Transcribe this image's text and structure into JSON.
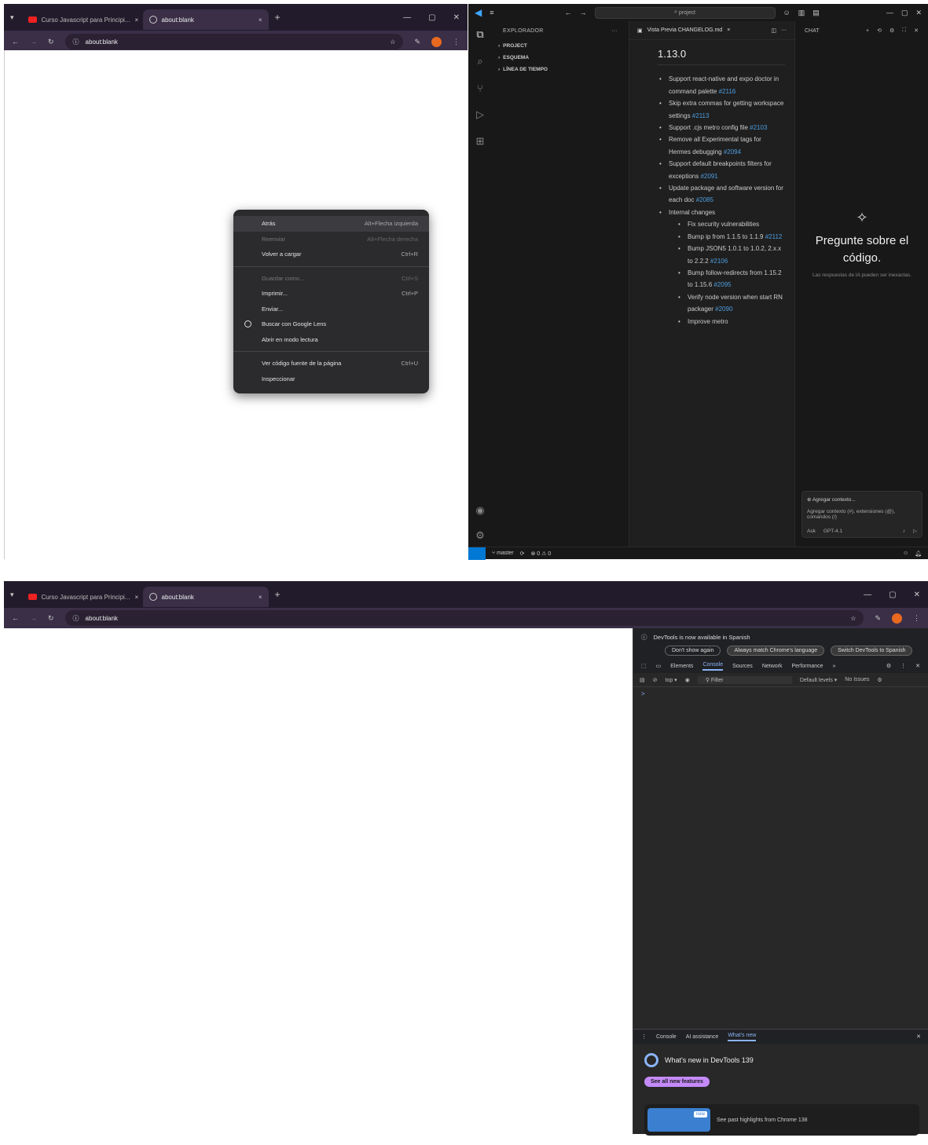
{
  "top_browser": {
    "tabs": [
      {
        "title": "Curso Javascript para Principi..."
      },
      {
        "title": "about:blank"
      }
    ],
    "new_tab": "+",
    "close": "×",
    "address": "about:blank",
    "controls": {
      "minimize": "—",
      "restore": "▢",
      "close": "✕"
    }
  },
  "context_menu": {
    "items": [
      {
        "label": "Atrás",
        "shortcut": "Alt+Flecha izquierda",
        "state": "highlight"
      },
      {
        "label": "Reenviar",
        "shortcut": "Alt+Flecha derecha",
        "state": "disabled"
      },
      {
        "label": "Volver a cargar",
        "shortcut": "Ctrl+R",
        "state": "normal"
      },
      {
        "sep": true
      },
      {
        "label": "Guardar como...",
        "shortcut": "Ctrl+S",
        "state": "disabled"
      },
      {
        "label": "Imprimir...",
        "shortcut": "Ctrl+P",
        "state": "normal"
      },
      {
        "label": "Enviar...",
        "shortcut": "",
        "state": "normal"
      },
      {
        "label": "Buscar con Google Lens",
        "shortcut": "",
        "state": "normal",
        "icon": "lens-icon"
      },
      {
        "label": "Abrir en modo lectura",
        "shortcut": "",
        "state": "normal"
      },
      {
        "sep": true
      },
      {
        "label": "Ver código fuente de la página",
        "shortcut": "Ctrl+U",
        "state": "normal"
      },
      {
        "label": "Inspeccionar",
        "shortcut": "",
        "state": "normal"
      }
    ]
  },
  "vscode": {
    "search": "project",
    "explorer_title": "EXPLORADOR",
    "explorer_items": [
      "PROJECT",
      "ESQUEMA",
      "LÍNEA DE TIEMPO"
    ],
    "editor_tab": "Vista Previa CHANGELOG.md",
    "changelog": {
      "version": "1.13.0",
      "items": [
        {
          "text": "Support react-native and expo doctor in command palette ",
          "link": "#2116"
        },
        {
          "text": "Skip extra commas for getting workspace settings ",
          "link": "#2113"
        },
        {
          "text": "Support .cjs metro config file ",
          "link": "#2103"
        },
        {
          "text": "Remove all Experimental tags for Hermes debugging ",
          "link": "#2094"
        },
        {
          "text": "Support default breakpoints filters for exceptions ",
          "link": "#2091"
        },
        {
          "text": "Update package and software version for each doc ",
          "link": "#2085"
        },
        {
          "text": "Internal changes",
          "link": "",
          "children": [
            {
              "text": "Fix security vulnerabilities",
              "link": ""
            },
            {
              "text": "Bump ip from 1.1.5 to 1.1.9 ",
              "link": "#2112"
            },
            {
              "text": "Bump JSON5 1.0.1 to 1.0.2, 2.x.x to 2.2.2 ",
              "link": "#2106"
            },
            {
              "text": "Bump follow-redirects from 1.15.2 to 1.15.6 ",
              "link": "#2095"
            },
            {
              "text": "Verify node version when start RN packager ",
              "link": "#2090"
            },
            {
              "text": "Improve metro",
              "link": ""
            }
          ]
        }
      ]
    },
    "chat": {
      "label": "CHAT",
      "title": "Pregunte sobre el código.",
      "subtitle": "Las respuestas de IA pueden ser inexactas.",
      "context_btn": "Agregar contexto...",
      "input_placeholder": "Agregar contexto (#), extensiones (@), comandos (/)",
      "mode": "Ask",
      "model": "GPT-4.1"
    },
    "status": {
      "branch": "master",
      "sync": "⟳",
      "problems": "⊗ 0 ⚠ 0"
    }
  },
  "bottom_browser": {
    "tabs": [
      {
        "title": "Curso Javascript para Principi..."
      },
      {
        "title": "about:blank"
      }
    ],
    "address": "about:blank"
  },
  "devtools": {
    "notice": "DevTools is now available in Spanish",
    "buttons": [
      "Don't show again",
      "Always match Chrome's language",
      "Switch DevTools to Spanish"
    ],
    "tabs": [
      "Elements",
      "Console",
      "Sources",
      "Network",
      "Performance",
      "»"
    ],
    "selected_tab": "Console",
    "console_toolbar": {
      "context": "top ▾",
      "filter": "Filter",
      "levels": "Default levels ▾",
      "issues": "No Issues"
    },
    "prompt": ">",
    "drawer_tabs": [
      "Console",
      "AI assistance",
      "What's new"
    ],
    "whats_new_title": "What's new in DevTools 139",
    "see_all": "See all new features",
    "highlights": "See past highlights from Chrome 138",
    "new_badge": "new"
  },
  "colors": {
    "accent": "#8ab4f8",
    "vscode_blue": "#0078d4",
    "chrome_tabstrip": "#221b2b",
    "pink": "#c58af9"
  }
}
